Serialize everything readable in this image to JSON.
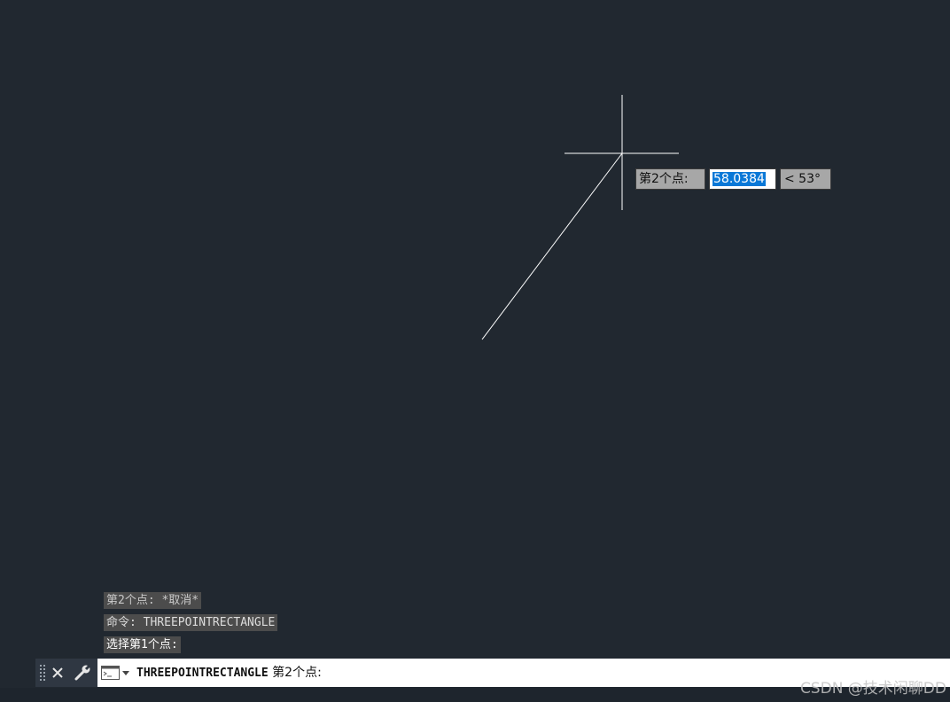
{
  "dynamic_input": {
    "prompt_label": "第2个点:",
    "length_value": "58.0384",
    "angle_value": "< 53°"
  },
  "command_history": [
    "第2个点: *取消*",
    "命令: THREEPOINTRECTANGLE",
    "选择第1个点:"
  ],
  "command_line": {
    "command_name": "THREEPOINTRECTANGLE",
    "prompt": "第2个点:"
  },
  "watermark": "CSDN @技术闲聊DD",
  "colors": {
    "background": "#212830",
    "highlight": "#0a78d7",
    "tooltip_gray": "#a7a7a7"
  }
}
